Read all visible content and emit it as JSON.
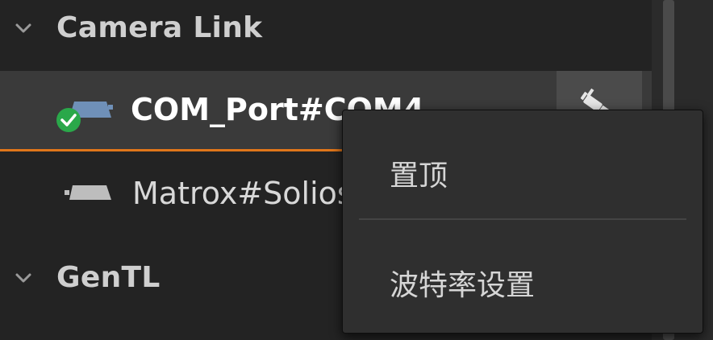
{
  "tree": {
    "groups": [
      {
        "name": "Camera Link",
        "expanded": true,
        "devices": [
          {
            "label": "COM_Port#COM4",
            "status": "connected",
            "status_icon": "check-circle-icon",
            "device_icon": "camera-link-device-icon",
            "selected": true,
            "action_icon": "disconnect-plug-icon"
          },
          {
            "label": "Matrox#Solios",
            "status": "idle",
            "device_icon": "camera-link-device-icon",
            "selected": false
          }
        ]
      },
      {
        "name": "GenTL",
        "expanded": true
      }
    ]
  },
  "context_menu": {
    "items": [
      {
        "label": "置顶"
      },
      {
        "label": "波特率设置"
      }
    ]
  },
  "colors": {
    "background": "#242424",
    "selected_row": "#3a3a3a",
    "accent_underline": "#e0761a",
    "status_ok": "#2aa84a",
    "menu_background": "#2f2f2f"
  }
}
